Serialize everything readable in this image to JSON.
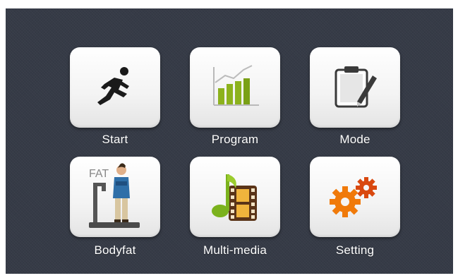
{
  "menu": {
    "items": [
      {
        "id": "start",
        "label": "Start",
        "icon": "running-man-icon"
      },
      {
        "id": "program",
        "label": "Program",
        "icon": "bar-chart-icon"
      },
      {
        "id": "mode",
        "label": "Mode",
        "icon": "clipboard-pen-icon"
      },
      {
        "id": "bodyfat",
        "label": "Bodyfat",
        "icon": "bodyfat-scale-icon",
        "icon_text": "FAT"
      },
      {
        "id": "multimedia",
        "label": "Multi-media",
        "icon": "music-film-icon"
      },
      {
        "id": "setting",
        "label": "Setting",
        "icon": "gears-icon"
      }
    ]
  },
  "colors": {
    "background": "#363b47",
    "tile": "#f5f5f5",
    "label": "#ffffff",
    "chart_green": "#8cb21d",
    "gear_orange": "#f07a0a"
  }
}
